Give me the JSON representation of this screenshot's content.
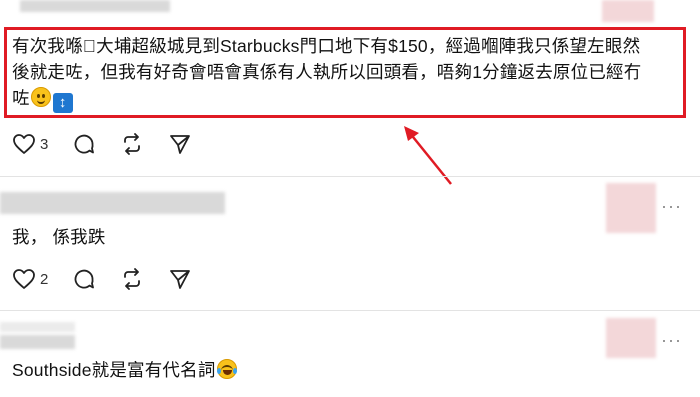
{
  "posts": [
    {
      "text_line1": "有次我喺\u0000大埔超級城見到Starbucks門口地下有$150，經過嗰陣我只係望左眼然",
      "text_line2": "後就走咗，但我有好奇會唔會真係有人執所以回頭看，唔夠1分鐘返去原位已經冇",
      "text_line3": "咗",
      "likes": "3",
      "emoji_1": "slightly-smiling-face",
      "emoji_2": "up-down-arrow"
    },
    {
      "text": "我， 係我跌",
      "likes": "2"
    },
    {
      "text": "Southside就是富有代名詞",
      "emoji": "face-with-tears-of-joy"
    }
  ],
  "more_label": "···",
  "colors": {
    "highlight": "#e01b24",
    "arrow": "#e01b24"
  }
}
